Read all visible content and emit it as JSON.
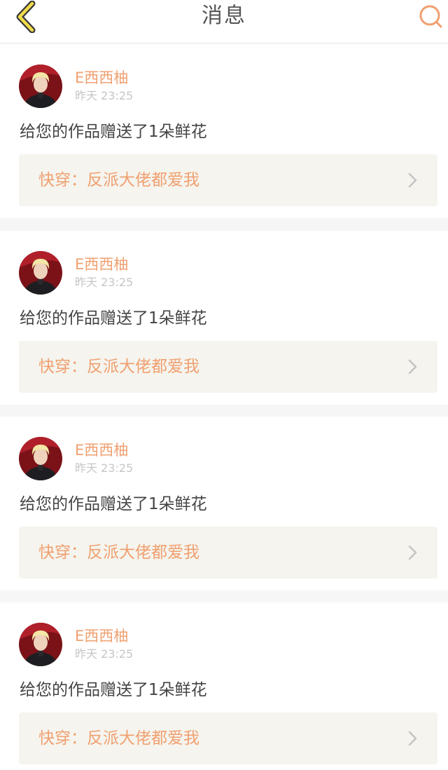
{
  "header": {
    "title": "消息",
    "accent_color": "#f0a070"
  },
  "messages": [
    {
      "username": "E西西柚",
      "time": "昨天  23:25",
      "text": "给您的作品赠送了1朵鲜花",
      "work_title": "快穿：反派大佬都爱我"
    },
    {
      "username": "E西西柚",
      "time": "昨天  23:25",
      "text": "给您的作品赠送了1朵鲜花",
      "work_title": "快穿：反派大佬都爱我"
    },
    {
      "username": "E西西柚",
      "time": "昨天  23:25",
      "text": "给您的作品赠送了1朵鲜花",
      "work_title": "快穿：反派大佬都爱我"
    },
    {
      "username": "E西西柚",
      "time": "昨天  23:25",
      "text": "给您的作品赠送了1朵鲜花",
      "work_title": "快穿：反派大佬都爱我"
    }
  ]
}
